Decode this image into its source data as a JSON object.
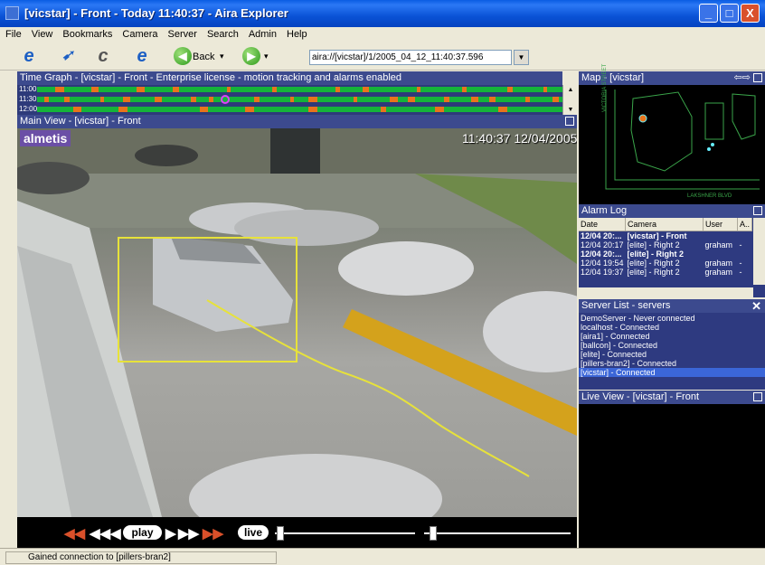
{
  "window": {
    "title": "[vicstar] - Front - Today 11:40:37 - Aira Explorer",
    "buttons": {
      "minimize": "_",
      "maximize": "□",
      "close": "X"
    }
  },
  "menu": [
    "File",
    "View",
    "Bookmarks",
    "Camera",
    "Server",
    "Search",
    "Admin",
    "Help"
  ],
  "toolbar": {
    "back_label": "Back",
    "address": "aira://[vicstar]/1/2005_04_12_11:40:37.596"
  },
  "time_graph": {
    "title": "Time Graph - [vicstar] - Front - Enterprise license - motion tracking and alarms enabled",
    "rows": [
      "11:00",
      "11:30",
      "12:00"
    ]
  },
  "main_view": {
    "title": "Main View - [vicstar] - Front",
    "logo": "almetis",
    "timestamp": "11:40:37 12/04/2005"
  },
  "playback": {
    "play_label": "play",
    "live_label": "live"
  },
  "map": {
    "title": "Map - [vicstar]",
    "street_label": "VICTORIA STREET",
    "blvd_label": "LAKSHNER BLVD"
  },
  "alarm_log": {
    "title": "Alarm Log",
    "columns": [
      "Date",
      "Camera",
      "User",
      "A.."
    ],
    "rows": [
      {
        "date": "12/04 20:...",
        "camera": "[vicstar] - Front",
        "user": "",
        "a": "",
        "bold": true
      },
      {
        "date": "12/04 20:17",
        "camera": "[elite] - Right 2",
        "user": "graham",
        "a": "-",
        "bold": false
      },
      {
        "date": "12/04 20:...",
        "camera": "[elite] - Right 2",
        "user": "",
        "a": "",
        "bold": true
      },
      {
        "date": "12/04 19:54",
        "camera": "[elite] - Right 2",
        "user": "graham",
        "a": "-",
        "bold": false
      },
      {
        "date": "12/04 19:37",
        "camera": "[elite] - Right 2",
        "user": "graham",
        "a": "-",
        "bold": false
      }
    ]
  },
  "server_list": {
    "title": "Server List - servers",
    "items": [
      "DemoServer - Never connected",
      "localhost - Connected",
      "[aira1] - Connected",
      "[ballcon] - Connected",
      "[elite] - Connected",
      "[pillers-bran2] - Connected",
      "[vicstar] - Connected"
    ]
  },
  "live_view": {
    "title": "Live View - [vicstar] - Front"
  },
  "status": {
    "text": "Gained connection to  [pillers-bran2]"
  },
  "colors": {
    "panel_header": "#3c4a8e",
    "tracking_box": "#e7e23a",
    "timeline_green": "#15b33a",
    "timeline_orange": "#e8741c"
  }
}
